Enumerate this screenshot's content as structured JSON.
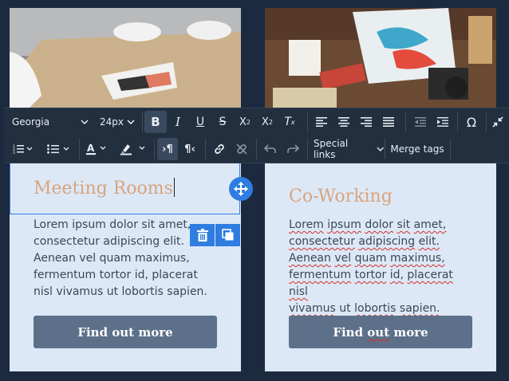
{
  "toolbar": {
    "font_family": "Georgia",
    "font_size": "24px",
    "special_links": "Special links",
    "merge_tags": "Merge tags"
  },
  "cards": [
    {
      "heading": "Meeting Rooms",
      "body": "Lorem ipsum dolor sit amet, consectetur adipiscing elit. Aenean vel quam maximus, fermentum tortor id, placerat nisl vivamus ut lobortis sapien.",
      "button": "Find out more"
    },
    {
      "heading": "Co-Working",
      "body_words": [
        "Lorem",
        "ipsum",
        "dolor",
        "sit",
        "amet,",
        "consectetur",
        "adipiscing",
        "elit.",
        "Aenean",
        "vel",
        "quam",
        "maximus,",
        "fermentum",
        "tortor",
        "id,",
        "placerat",
        "nisl",
        "vivamus",
        "ut",
        "lobortis",
        "sapien."
      ],
      "button": "Find out more"
    }
  ],
  "colors": {
    "background": "#1b2a3e",
    "card": "#dde8f6",
    "heading": "#d8a47d",
    "button": "#5c7089",
    "toolbar": "#222f3f",
    "accent": "#2f7de1"
  }
}
